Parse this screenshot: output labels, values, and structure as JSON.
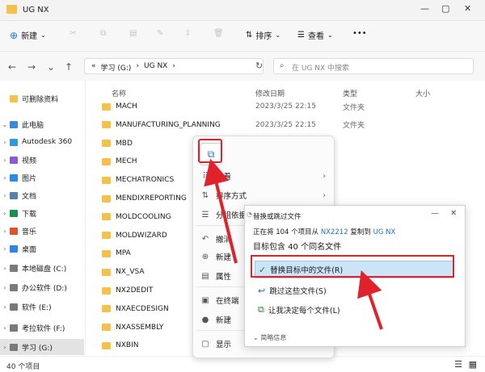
{
  "window": {
    "title": "UG NX"
  },
  "toolbar": {
    "new": "新建",
    "sort": "排序",
    "view": "查看",
    "more": "•••"
  },
  "address": {
    "crumbs": [
      "«",
      "学习 (G:)",
      "›",
      "UG NX",
      "›"
    ],
    "search_placeholder": "在 UG NX 中搜索"
  },
  "columns": {
    "name": "名称",
    "date": "修改日期",
    "type": "类型",
    "size": "大小"
  },
  "sidebar": [
    {
      "label": "可删除资料",
      "chev": "",
      "color": "#f4c24a"
    },
    {
      "label": "此电脑",
      "chev": "⌄",
      "color": "#3a8ad8"
    },
    {
      "label": "Autodesk 360",
      "chev": "›",
      "color": "#2f9bd6"
    },
    {
      "label": "视频",
      "chev": "›",
      "color": "#8a5bd4"
    },
    {
      "label": "图片",
      "chev": "›",
      "color": "#2e8ae0"
    },
    {
      "label": "文档",
      "chev": "›",
      "color": "#5a7fa8"
    },
    {
      "label": "下载",
      "chev": "›",
      "color": "#1b8f4e"
    },
    {
      "label": "音乐",
      "chev": "›",
      "color": "#e0522d"
    },
    {
      "label": "桌面",
      "chev": "›",
      "color": "#2e86e0"
    },
    {
      "label": "本地磁盘 (C:)",
      "chev": "›",
      "color": "#7a7a7a"
    },
    {
      "label": "办公软件 (D:)",
      "chev": "›",
      "color": "#7a7a7a"
    },
    {
      "label": "软件 (E:)",
      "chev": "›",
      "color": "#7a7a7a"
    },
    {
      "label": "考拉软件 (F:)",
      "chev": "›",
      "color": "#7a7a7a"
    },
    {
      "label": "学习 (G:)",
      "chev": "›",
      "color": "#7a7a7a"
    }
  ],
  "files": [
    {
      "name": "MACH",
      "date": "2023/3/25 22:15",
      "type": "文件夹"
    },
    {
      "name": "MANUFACTURING_PLANNING",
      "date": "2023/3/25 22:15",
      "type": "文件夹"
    },
    {
      "name": "MBD",
      "date": "",
      "type": ""
    },
    {
      "name": "MECH",
      "date": "",
      "type": ""
    },
    {
      "name": "MECHATRONICS",
      "date": "",
      "type": ""
    },
    {
      "name": "MENDIXREPORTING",
      "date": "",
      "type": ""
    },
    {
      "name": "MOLDCOOLING",
      "date": "",
      "type": ""
    },
    {
      "name": "MOLDWIZARD",
      "date": "",
      "type": ""
    },
    {
      "name": "MPA",
      "date": "",
      "type": ""
    },
    {
      "name": "NX_VSA",
      "date": "",
      "type": ""
    },
    {
      "name": "NX2DEDIT",
      "date": "",
      "type": ""
    },
    {
      "name": "NXAECDESIGN",
      "date": "",
      "type": ""
    },
    {
      "name": "NXASSEMBLY",
      "date": "",
      "type": ""
    },
    {
      "name": "NXBIN",
      "date": "",
      "type": ""
    }
  ],
  "context_menu": {
    "paste_icon": "⧉",
    "items": [
      {
        "icon": "⠿",
        "label": "查看",
        "arrow": "›"
      },
      {
        "icon": "⇅",
        "label": "排序方式",
        "arrow": "›"
      },
      {
        "icon": "☰",
        "label": "分组依据",
        "arrow": ""
      },
      {
        "icon": "↶",
        "label": "撤消",
        "arrow": ""
      },
      {
        "icon": "⊕",
        "label": "新建",
        "arrow": ""
      },
      {
        "icon": "▤",
        "label": "属性",
        "arrow": ""
      },
      {
        "icon": "▣",
        "label": "在终端",
        "arrow": ""
      },
      {
        "icon": "●",
        "label": "新建",
        "arrow": ""
      },
      {
        "icon": "▢",
        "label": "显示",
        "arrow": ""
      }
    ]
  },
  "dialog": {
    "title": "替换或跳过文件",
    "info_a": "正在将 104 个项目从",
    "src": "NX2212",
    "info_b": "复制到",
    "dst": "UG NX",
    "heading": "目标包含 40 个同名文件",
    "options": [
      "替换目标中的文件(R)",
      "跳过这些文件(S)",
      "让我决定每个文件(L)"
    ],
    "footer": "⌄ 简略信息"
  },
  "status": {
    "count": "40 个项目"
  },
  "colors": {
    "accent": "#1a73c8",
    "folder": "#f4c24a",
    "annotation": "#e0222a",
    "highlight": "#cce4f7"
  }
}
